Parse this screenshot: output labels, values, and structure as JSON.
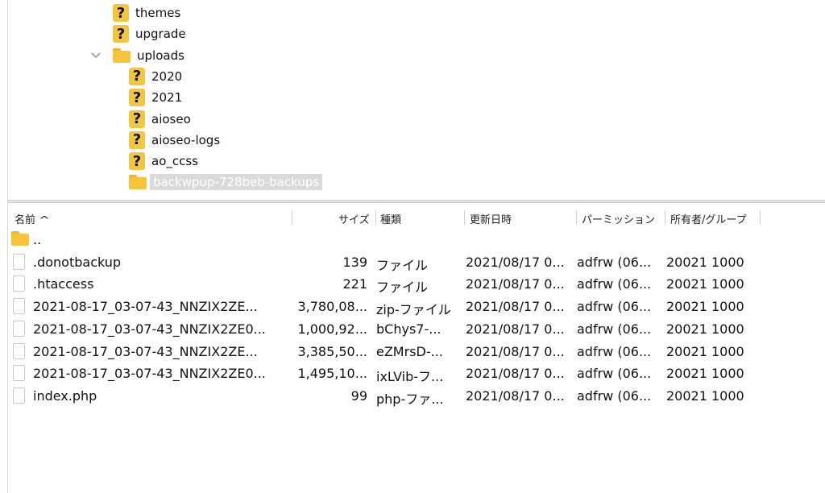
{
  "tree": {
    "items": [
      {
        "label": "themes",
        "icon": "question-folder-icon",
        "level": 1
      },
      {
        "label": "upgrade",
        "icon": "question-folder-icon",
        "level": 1
      },
      {
        "label": "uploads",
        "icon": "folder-icon",
        "level": 1,
        "expanded": true
      },
      {
        "label": "2020",
        "icon": "question-folder-icon",
        "level": 2
      },
      {
        "label": "2021",
        "icon": "question-folder-icon",
        "level": 2
      },
      {
        "label": "aioseo",
        "icon": "question-folder-icon",
        "level": 2
      },
      {
        "label": "aioseo-logs",
        "icon": "question-folder-icon",
        "level": 2
      },
      {
        "label": "ao_ccss",
        "icon": "question-folder-icon",
        "level": 2
      },
      {
        "label": "backwpup-728beb-backups",
        "icon": "folder-icon",
        "level": 2,
        "selected": true
      }
    ]
  },
  "file_list": {
    "columns": {
      "name": "名前",
      "size": "サイズ",
      "type": "種類",
      "modified": "更新日時",
      "permissions": "パーミッション",
      "owner": "所有者/グループ"
    },
    "sort": {
      "column": "name",
      "direction": "ascending",
      "icon": "chevron-up-icon"
    },
    "rows": [
      {
        "name": "..",
        "icon": "folder-icon",
        "size": "",
        "type": "",
        "modified": "",
        "permissions": "",
        "owner": ""
      },
      {
        "name": ".donotbackup",
        "icon": "file-icon",
        "size": "139",
        "type": "ファイル",
        "modified": "2021/08/17 0...",
        "permissions": "adfrw (06...",
        "owner": "20021 1000"
      },
      {
        "name": ".htaccess",
        "icon": "file-icon",
        "size": "221",
        "type": "ファイル",
        "modified": "2021/08/17 0...",
        "permissions": "adfrw (06...",
        "owner": "20021 1000"
      },
      {
        "name": "2021-08-17_03-07-43_NNZIX2ZE...",
        "icon": "file-icon",
        "size": "3,780,08...",
        "type": "zip-ファイル",
        "modified": "2021/08/17 0...",
        "permissions": "adfrw (06...",
        "owner": "20021 1000"
      },
      {
        "name": "2021-08-17_03-07-43_NNZIX2ZE0...",
        "icon": "file-icon",
        "size": "1,000,92...",
        "type": "bChys7-...",
        "modified": "2021/08/17 0...",
        "permissions": "adfrw (06...",
        "owner": "20021 1000"
      },
      {
        "name": "2021-08-17_03-07-43_NNZIX2ZE...",
        "icon": "file-icon",
        "size": "3,385,50...",
        "type": "eZMrsD-...",
        "modified": "2021/08/17 0...",
        "permissions": "adfrw (06...",
        "owner": "20021 1000"
      },
      {
        "name": "2021-08-17_03-07-43_NNZIX2ZE0...",
        "icon": "file-icon",
        "size": "1,495,10...",
        "type": "ixLVib-フ...",
        "modified": "2021/08/17 0...",
        "permissions": "adfrw (06...",
        "owner": "20021 1000"
      },
      {
        "name": "index.php",
        "icon": "file-icon",
        "size": "99",
        "type": "php-ファ...",
        "modified": "2021/08/17 0...",
        "permissions": "adfrw (06...",
        "owner": "20021 1000"
      }
    ]
  },
  "colors": {
    "folder": "#f7c23c",
    "selection": "#dadada",
    "divider": "#d2d2d2"
  }
}
